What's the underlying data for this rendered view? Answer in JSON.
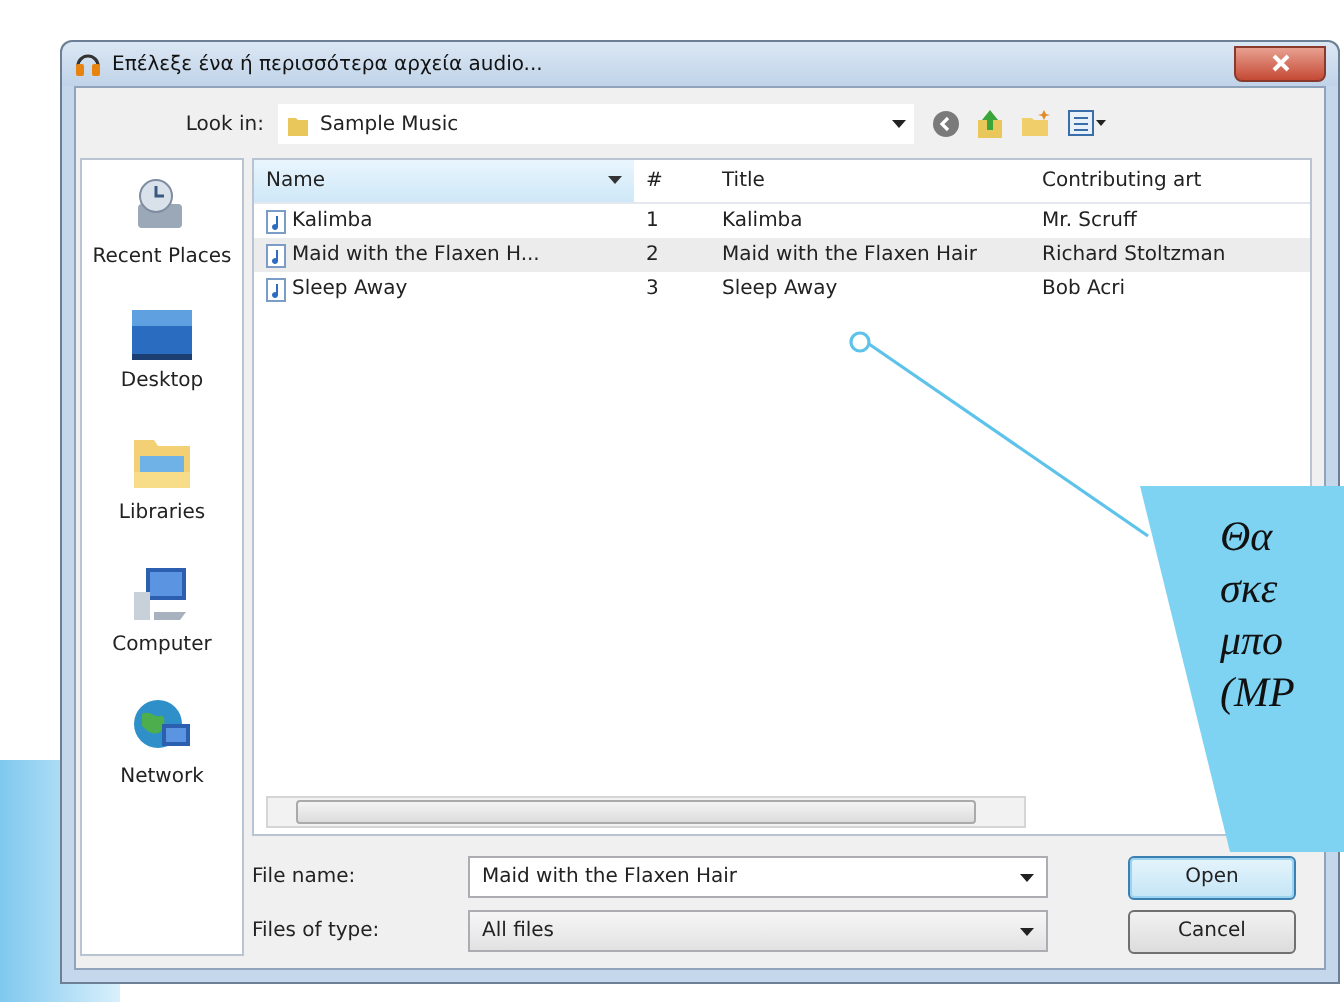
{
  "window": {
    "title": "Επέλεξε ένα ή περισσότερα αρχεία audio..."
  },
  "look_in": {
    "label": "Look in:",
    "value": "Sample Music"
  },
  "places": [
    {
      "label": "Recent Places",
      "kind": "recent"
    },
    {
      "label": "Desktop",
      "kind": "desktop"
    },
    {
      "label": "Libraries",
      "kind": "libraries"
    },
    {
      "label": "Computer",
      "kind": "computer"
    },
    {
      "label": "Network",
      "kind": "network"
    }
  ],
  "table": {
    "columns": [
      "Name",
      "#",
      "Title",
      "Contributing art"
    ],
    "rows": [
      {
        "cells": [
          "Kalimba",
          "1",
          "Kalimba",
          "Mr. Scruff"
        ],
        "selected": false
      },
      {
        "cells": [
          "Maid with the Flaxen H...",
          "2",
          "Maid with the Flaxen Hair",
          "Richard Stoltzman"
        ],
        "selected": true
      },
      {
        "cells": [
          "Sleep Away",
          "3",
          "Sleep Away",
          "Bob Acri"
        ],
        "selected": false
      }
    ]
  },
  "file_name": {
    "label": "File name:",
    "value": "Maid with the Flaxen Hair"
  },
  "file_type": {
    "label": "Files of type:",
    "value": "All files"
  },
  "buttons": [
    {
      "label": "Open",
      "default": true
    },
    {
      "label": "Cancel",
      "default": false
    }
  ],
  "callout": {
    "lines": [
      "Θα",
      "σκε",
      "μπο",
      "(ΜΡ"
    ]
  }
}
